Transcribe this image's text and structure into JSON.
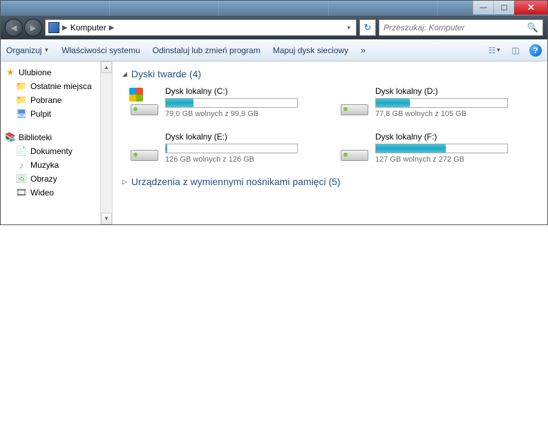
{
  "address": {
    "location": "Komputer"
  },
  "search": {
    "placeholder": "Przeszukaj: Komputer"
  },
  "toolbar": {
    "organize": "Organizuj",
    "properties": "Właściwości systemu",
    "uninstall": "Odinstaluj lub zmień program",
    "mapdrive": "Mapuj dysk sieciowy"
  },
  "sidebar": {
    "favorites": {
      "label": "Ulubione",
      "items": [
        {
          "label": "Ostatnie miejsca"
        },
        {
          "label": "Pobrane"
        },
        {
          "label": "Pulpit"
        }
      ]
    },
    "libraries": {
      "label": "Biblioteki",
      "items": [
        {
          "label": "Dokumenty"
        },
        {
          "label": "Muzyka"
        },
        {
          "label": "Obrazy"
        },
        {
          "label": "Wideo"
        }
      ]
    }
  },
  "sections": {
    "hdd": {
      "label": "Dyski twarde (4)"
    },
    "removable": {
      "label": "Urządzenia z wymiennymi nośnikami pamięci (5)"
    }
  },
  "drives": [
    {
      "name": "Dysk lokalny (C:)",
      "stat": "79,0 GB wolnych z 99,9 GB",
      "fill": 21,
      "sys": true
    },
    {
      "name": "Dysk lokalny (D:)",
      "stat": "77,8 GB wolnych z 105 GB",
      "fill": 26,
      "sys": false
    },
    {
      "name": "Dysk lokalny (E:)",
      "stat": "126 GB wolnych z 126 GB",
      "fill": 1,
      "sys": false
    },
    {
      "name": "Dysk lokalny (F:)",
      "stat": "127 GB wolnych z 272 GB",
      "fill": 53,
      "sys": false
    }
  ]
}
